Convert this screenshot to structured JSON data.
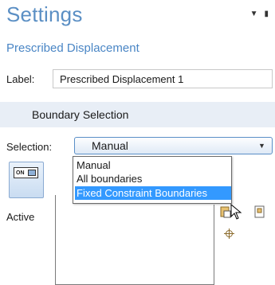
{
  "header": {
    "title": "Settings",
    "subtitle": "Prescribed Displacement",
    "dropdown_arrow_icon": "triangle-down-icon",
    "pin_icon": "pin-icon"
  },
  "label_row": {
    "label": "Label:",
    "value": "Prescribed Displacement 1"
  },
  "section": {
    "title": "Boundary Selection"
  },
  "selection": {
    "label": "Selection:",
    "value": "Manual",
    "options": [
      "Manual",
      "All boundaries",
      "Fixed Constraint Boundaries"
    ],
    "highlighted_index": 2
  },
  "active_toggle": {
    "badge": "ON",
    "label": "Active"
  },
  "colors": {
    "title": "#5b8fc4",
    "subtitle": "#4a86c5",
    "section_bg": "#e8eef6",
    "highlight": "#3399ff"
  }
}
